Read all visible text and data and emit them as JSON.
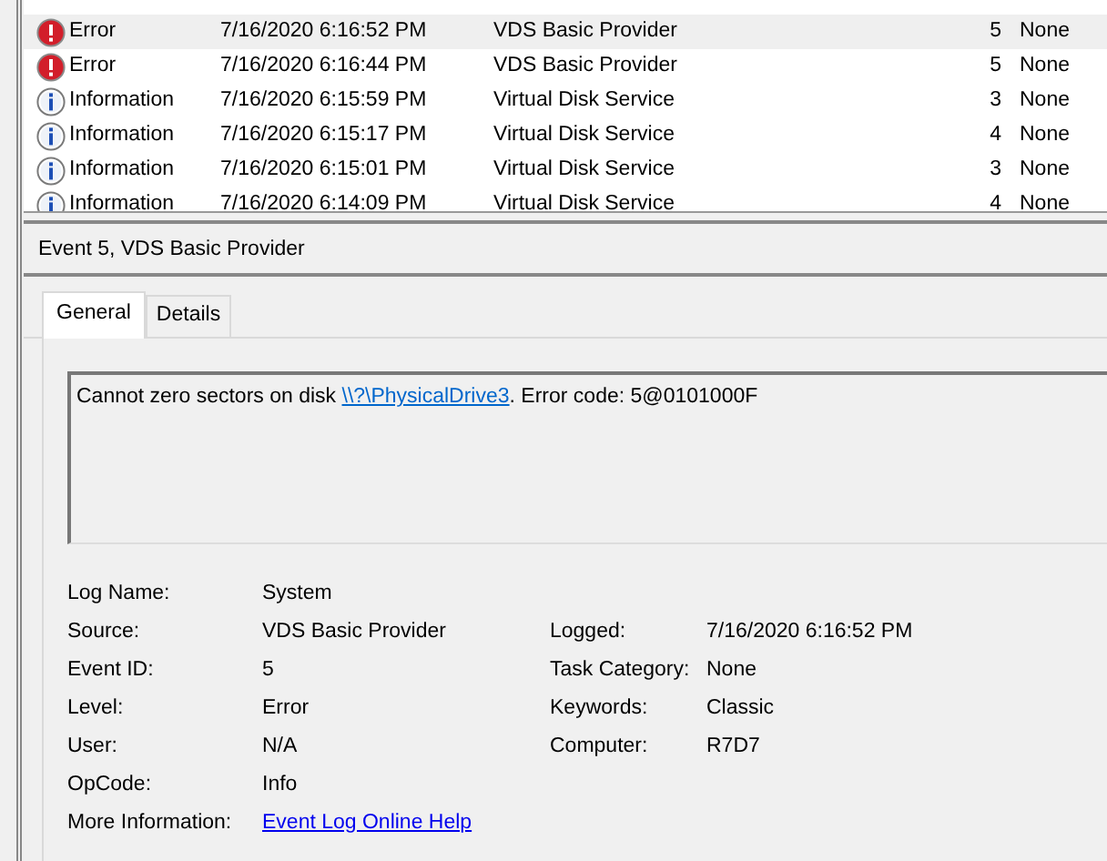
{
  "events": [
    {
      "kind": "error",
      "level": "Error",
      "date": "7/16/2020 6:16:52 PM",
      "source": "VDS Basic Provider",
      "event_id": "5",
      "task": "None",
      "selected": true
    },
    {
      "kind": "error",
      "level": "Error",
      "date": "7/16/2020 6:16:44 PM",
      "source": "VDS Basic Provider",
      "event_id": "5",
      "task": "None",
      "selected": false
    },
    {
      "kind": "info",
      "level": "Information",
      "date": "7/16/2020 6:15:59 PM",
      "source": "Virtual Disk Service",
      "event_id": "3",
      "task": "None",
      "selected": false
    },
    {
      "kind": "info",
      "level": "Information",
      "date": "7/16/2020 6:15:17 PM",
      "source": "Virtual Disk Service",
      "event_id": "4",
      "task": "None",
      "selected": false
    },
    {
      "kind": "info",
      "level": "Information",
      "date": "7/16/2020 6:15:01 PM",
      "source": "Virtual Disk Service",
      "event_id": "3",
      "task": "None",
      "selected": false
    },
    {
      "kind": "info",
      "level": "Information",
      "date": "7/16/2020 6:14:09 PM",
      "source": "Virtual Disk Service",
      "event_id": "4",
      "task": "None",
      "selected": false
    }
  ],
  "details": {
    "title": "Event 5, VDS Basic Provider",
    "tabs": [
      {
        "label": "General",
        "selected": true
      },
      {
        "label": "Details",
        "selected": false
      }
    ],
    "message": {
      "before": "Cannot zero sectors on disk ",
      "link": "\\\\?\\PhysicalDrive3",
      "after": ". Error code: 5@0101000F"
    },
    "fields": [
      {
        "label": "Log Name:",
        "value": "System"
      },
      {
        "label": "Source:",
        "value": "VDS Basic Provider",
        "label_2": "Logged:",
        "value_2": "7/16/2020 6:16:52 PM"
      },
      {
        "label": "Event ID:",
        "value": "5",
        "label_2": "Task Category:",
        "value_2": "None"
      },
      {
        "label": "Level:",
        "value": "Error",
        "label_2": "Keywords:",
        "value_2": "Classic"
      },
      {
        "label": "User:",
        "value": "N/A",
        "label_2": "Computer:",
        "value_2": "R7D7"
      },
      {
        "label": "OpCode:",
        "value": "Info"
      },
      {
        "label": "More Information:",
        "link": "Event Log Online Help"
      }
    ]
  }
}
